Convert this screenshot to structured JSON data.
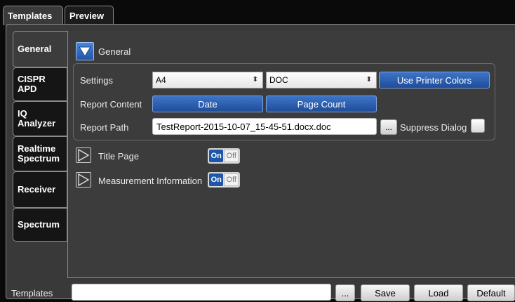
{
  "top_tabs": [
    {
      "label": "Templates",
      "active": true
    },
    {
      "label": "Preview",
      "active": false
    }
  ],
  "side_tabs": [
    {
      "label": "General",
      "active": true
    },
    {
      "label": "CISPR APD"
    },
    {
      "label": "IQ Analyzer"
    },
    {
      "label": "Realtime Spectrum"
    },
    {
      "label": "Receiver"
    },
    {
      "label": "Spectrum"
    }
  ],
  "general": {
    "header_label": "General",
    "settings_label": "Settings",
    "paper_size": "A4",
    "format": "DOC",
    "printer_colors_label": "Use Printer Colors",
    "report_content_label": "Report Content",
    "date_label": "Date",
    "page_count_label": "Page Count",
    "report_path_label": "Report Path",
    "report_path_value": "TestReport-2015-10-07_15-45-51.docx.doc",
    "browse_label": "...",
    "suppress_dialog_label": "Suppress Dialog"
  },
  "sections": [
    {
      "label": "Title Page",
      "state": "On"
    },
    {
      "label": "Measurement Information",
      "state": "On"
    }
  ],
  "toggle": {
    "on": "On",
    "off": "Off"
  },
  "footer": {
    "templates_label": "Templates",
    "templates_value": "",
    "browse_label": "...",
    "save_label": "Save",
    "load_label": "Load",
    "default_label": "Default"
  },
  "colors": {
    "accent_blue": "#1f56a8",
    "background": "#3c3c3c"
  }
}
